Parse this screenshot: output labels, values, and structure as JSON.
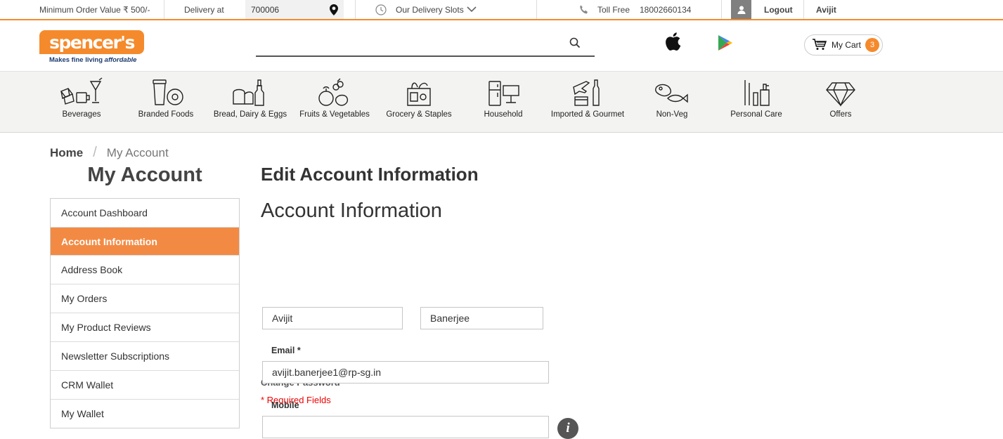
{
  "topbar": {
    "min_order": "Minimum Order Value ₹ 500/-",
    "delivery_label": "Delivery at",
    "pincode": "700006",
    "delivery_slots": "Our Delivery Slots",
    "toll_free_label": "Toll Free",
    "toll_free_number": "18002660134",
    "logout": "Logout",
    "user_name": "Avijit"
  },
  "header": {
    "logo_text": "spencer's",
    "tagline_plain": "Makes fine living ",
    "tagline_italic": "affordable",
    "search_placeholder": "",
    "cart_label": "My Cart",
    "cart_count": "3"
  },
  "categories": [
    {
      "label": "Beverages",
      "icon": "beverages-icon"
    },
    {
      "label": "Branded Foods",
      "icon": "branded-foods-icon"
    },
    {
      "label": "Bread, Dairy & Eggs",
      "icon": "bread-dairy-icon"
    },
    {
      "label": "Fruits & Vegetables",
      "icon": "fruits-vegetables-icon"
    },
    {
      "label": "Grocery & Staples",
      "icon": "grocery-icon"
    },
    {
      "label": "Household",
      "icon": "household-icon"
    },
    {
      "label": "Imported & Gourmet",
      "icon": "imported-gourmet-icon"
    },
    {
      "label": "Non-Veg",
      "icon": "non-veg-icon"
    },
    {
      "label": "Personal Care",
      "icon": "personal-care-icon"
    },
    {
      "label": "Offers",
      "icon": "offers-diamond-icon"
    }
  ],
  "breadcrumb": {
    "home": "Home",
    "separator": "/",
    "current": "My Account"
  },
  "sidebar": {
    "title": "My Account",
    "items": [
      {
        "label": "Account Dashboard"
      },
      {
        "label": "Account Information"
      },
      {
        "label": "Address Book"
      },
      {
        "label": "My Orders"
      },
      {
        "label": "My Product Reviews"
      },
      {
        "label": "Newsletter Subscriptions"
      },
      {
        "label": "CRM Wallet"
      },
      {
        "label": "My Wallet"
      }
    ],
    "active_index": 1
  },
  "main": {
    "page_title": "Edit Account Information",
    "section_title": "Account Information",
    "first_name": "Avijit",
    "last_name": "Banerjee",
    "email_label": "Email",
    "email_required_mark": "*",
    "email_value": "avijit.banerjee1@rp-sg.in",
    "change_password": "Change Password",
    "required_note": "* Required Fields",
    "mobile_label": "Mobile",
    "mobile_value": "",
    "info_icon": "i"
  },
  "colors": {
    "accent": "#f58a2c",
    "active_menu": "#f38a43",
    "required": "#e00000"
  }
}
